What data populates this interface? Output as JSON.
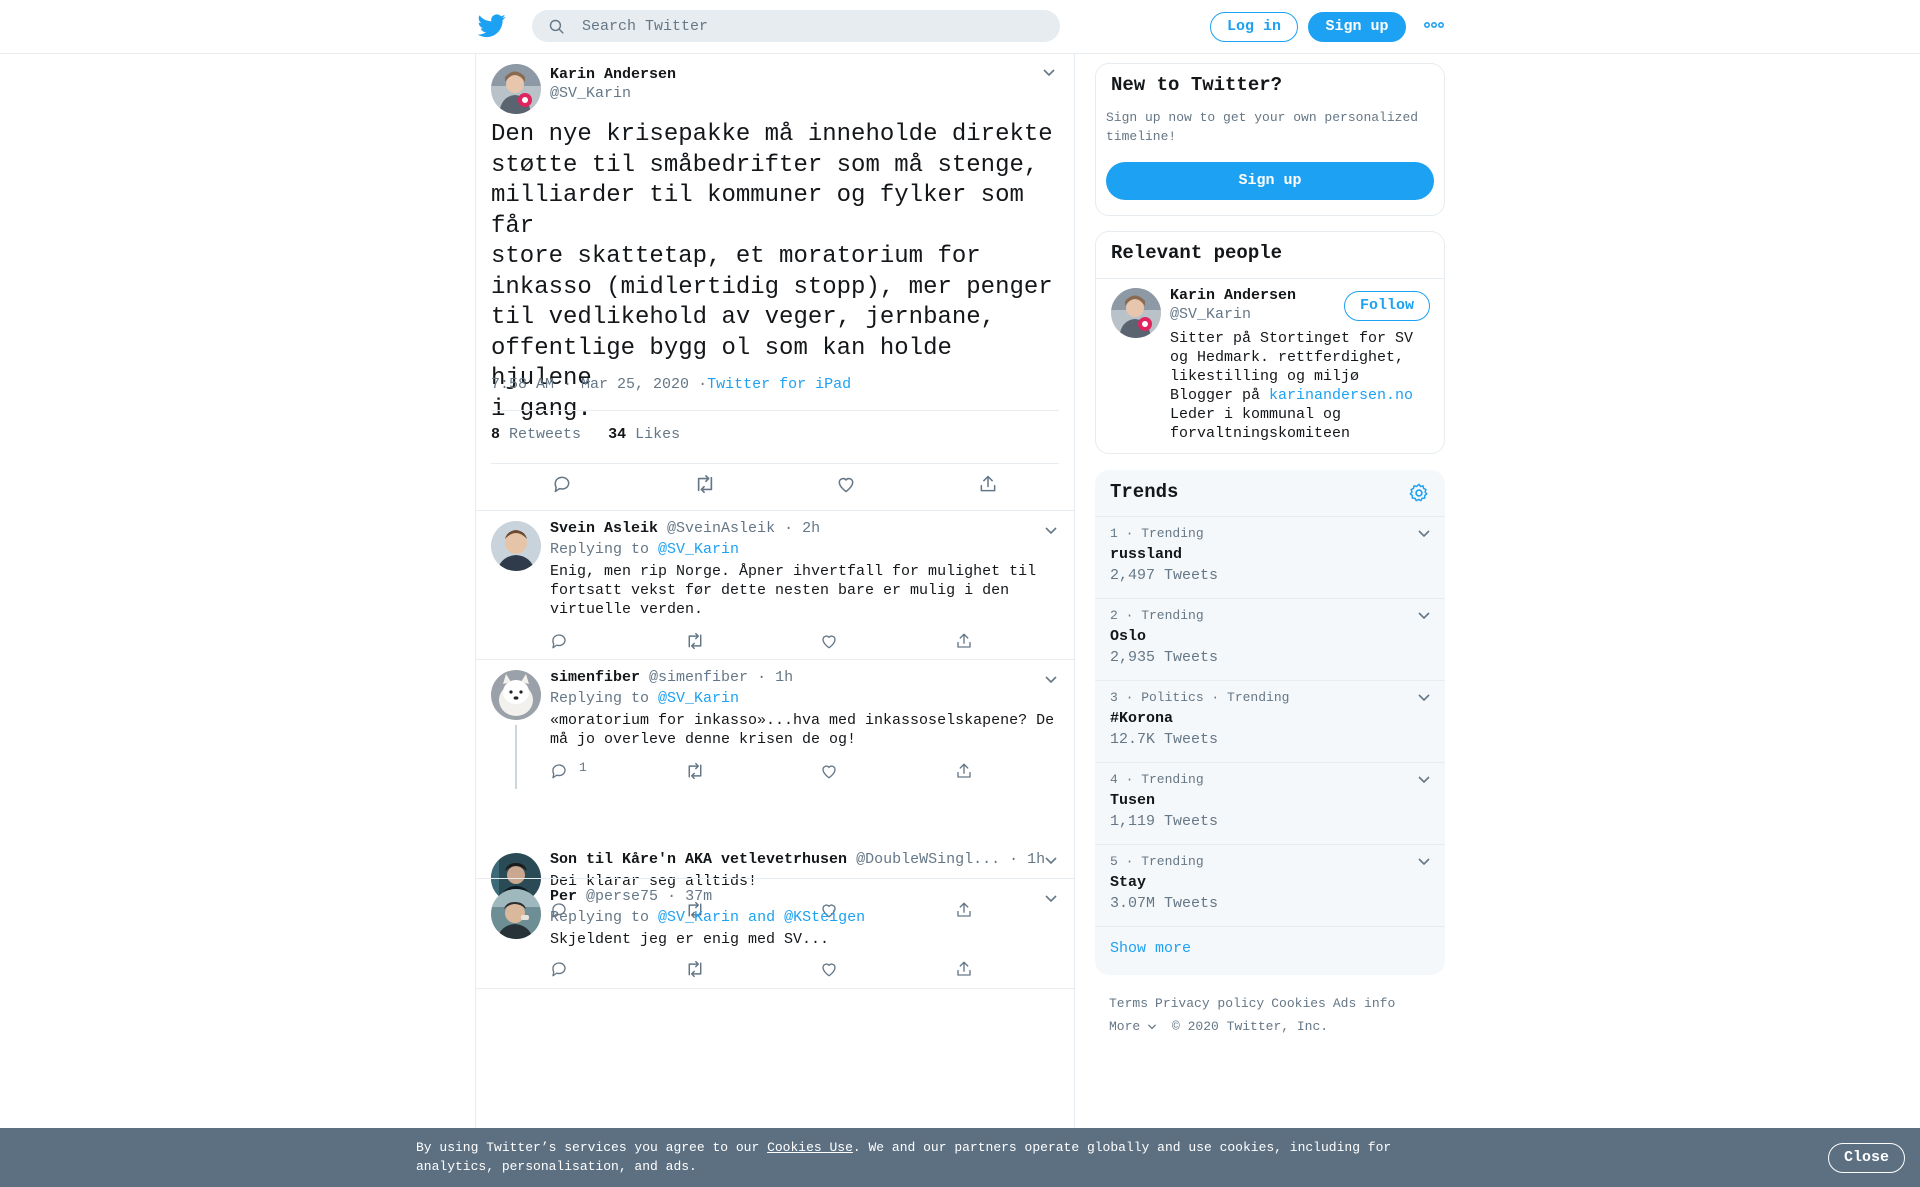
{
  "header": {
    "logo_icon": "twitter-bird-icon",
    "search_placeholder": "Search Twitter",
    "login_label": "Log in",
    "signup_label": "Sign up",
    "more_icon": "more-dots-icon"
  },
  "focus_tweet": {
    "name": "Karin Andersen",
    "handle": "@SV_Karin",
    "text": "Den nye krisepakke må inneholde direkte\nstøtte til småbedrifter som må stenge,\nmilliarder til kommuner og fylker som får\nstore skattetap, et moratorium for\ninkasso (midlertidig stopp), mer penger\ntil vedlikehold av veger, jernbane,\noffentlige bygg ol som kan holde hjulene\ni gang.",
    "timestamp": "7:58 AM · Mar 25, 2020",
    "separator": "·",
    "source": "Twitter for iPad",
    "retweets_count": "8",
    "retweets_label": "Retweets",
    "likes_count": "34",
    "likes_label": "Likes"
  },
  "replies": [
    {
      "name": "Svein Asleik",
      "handle": "@SveinAsleik",
      "time": "· 2h",
      "replying_prefix": "Replying to",
      "replying_to": "@SV_Karin",
      "text": "Enig, men rip Norge. Åpner ihvertfall for mulighet til fortsatt vekst før dette nesten bare er mulig i den virtuelle verden."
    },
    {
      "name": "simenfiber",
      "handle": "@simenfiber",
      "time": "· 1h",
      "replying_prefix": "Replying to",
      "replying_to": "@SV_Karin",
      "text": "«moratorium for inkasso»...hva med inkassoselskapene? De må jo overleve denne krisen de og!",
      "reply_count": "1"
    },
    {
      "name": "Son til Kåre'n AKA vetlevetrhusen",
      "handle": "@DoubleWSingl...",
      "time": "· 1h",
      "text": "Dei klarar seg alltids!"
    },
    {
      "name": "Per",
      "handle": "@perse75",
      "time": "· 37m",
      "replying_prefix": "Replying to",
      "replying_to": "@SV_Karin and @KSteigen",
      "text": "Skjeldent jeg er enig med SV..."
    }
  ],
  "sidebar": {
    "new_to_twitter": {
      "title": "New to Twitter?",
      "description": "Sign up now to get your own personalized timeline!",
      "signup_label": "Sign up"
    },
    "relevant_people": {
      "title": "Relevant people",
      "name": "Karin Andersen",
      "handle": "@SV_Karin",
      "follow_label": "Follow",
      "bio_line1": "Sitter på Stortinget for SV og Hedmark. rettferdighet, likestilling og miljø",
      "bio_blogger": "Blogger på",
      "bio_link": "karinandersen.no",
      "bio_line3": "Leder i kommunal og forvaltningskomiteen"
    },
    "trends": {
      "title": "Trends",
      "settings_icon": "gear-icon",
      "items": [
        {
          "meta": "1 · Trending",
          "name": "russland",
          "count": "2,497 Tweets"
        },
        {
          "meta": "2 · Trending",
          "name": "Oslo",
          "count": "2,935 Tweets"
        },
        {
          "meta": "3 · Politics · Trending",
          "name": "#Korona",
          "count": "12.7K Tweets"
        },
        {
          "meta": "4 · Trending",
          "name": "Tusen",
          "count": "1,119 Tweets"
        },
        {
          "meta": "5 · Trending",
          "name": "Stay",
          "count": "3.07M Tweets"
        }
      ],
      "show_more": "Show more"
    },
    "footer": {
      "terms": "Terms",
      "privacy": "Privacy policy",
      "cookies": "Cookies",
      "ads": "Ads info",
      "more": "More",
      "copyright": "© 2020 Twitter, Inc."
    }
  },
  "cookie_bar": {
    "prefix": "By using Twitter’s services you agree to our",
    "link": "Cookies Use",
    "suffix": ". We and our partners operate globally and use cookies, including for analytics, personalisation, and ads.",
    "close_label": "Close"
  },
  "colors": {
    "accent": "#1da1f2",
    "text": "#14171a",
    "secondary": "#657786",
    "border": "#e6ecf0",
    "cookie_bg": "#5d7082"
  }
}
